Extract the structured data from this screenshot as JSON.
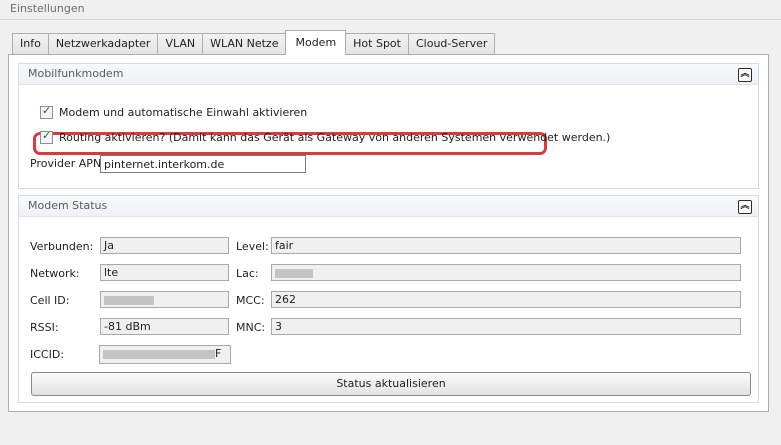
{
  "window": {
    "title": "Einstellungen"
  },
  "tabs": [
    {
      "label": "Info"
    },
    {
      "label": "Netzwerkadapter"
    },
    {
      "label": "VLAN"
    },
    {
      "label": "WLAN Netze"
    },
    {
      "label": "Modem",
      "active": true
    },
    {
      "label": "Hot Spot"
    },
    {
      "label": "Cloud-Server"
    }
  ],
  "mobilfunk": {
    "title": "Mobilfunkmodem",
    "collapse_icon": "double-chevron-up-icon",
    "enable_modem": {
      "label": "Modem und automatische Einwahl aktivieren",
      "checked": true
    },
    "enable_routing": {
      "label": "Routing aktivieren? (Damit kann das Gerät als Gateway von anderen Systemen verwendet werden.)",
      "checked": true
    },
    "apn": {
      "label": "Provider APN",
      "value": "pinternet.interkom.de"
    }
  },
  "status": {
    "title": "Modem Status",
    "collapse_icon": "double-chevron-up-icon",
    "connected": {
      "label": "Verbunden:",
      "value": "Ja"
    },
    "level": {
      "label": "Level:",
      "value": "fair"
    },
    "network": {
      "label": "Network:",
      "value": "lte"
    },
    "lac": {
      "label": "Lac:",
      "value": ""
    },
    "cell_id": {
      "label": "Cell ID:",
      "value": ""
    },
    "mcc": {
      "label": "MCC:",
      "value": "262"
    },
    "rssi": {
      "label": "RSSI:",
      "value": "-81 dBm"
    },
    "mnc": {
      "label": "MNC:",
      "value": "3"
    },
    "iccid": {
      "label": "ICCID:",
      "value": "F"
    },
    "refresh_button": "Status aktualisieren"
  },
  "colors": {
    "highlight": "#d83b3b",
    "checkmark": "#2a4f86"
  }
}
